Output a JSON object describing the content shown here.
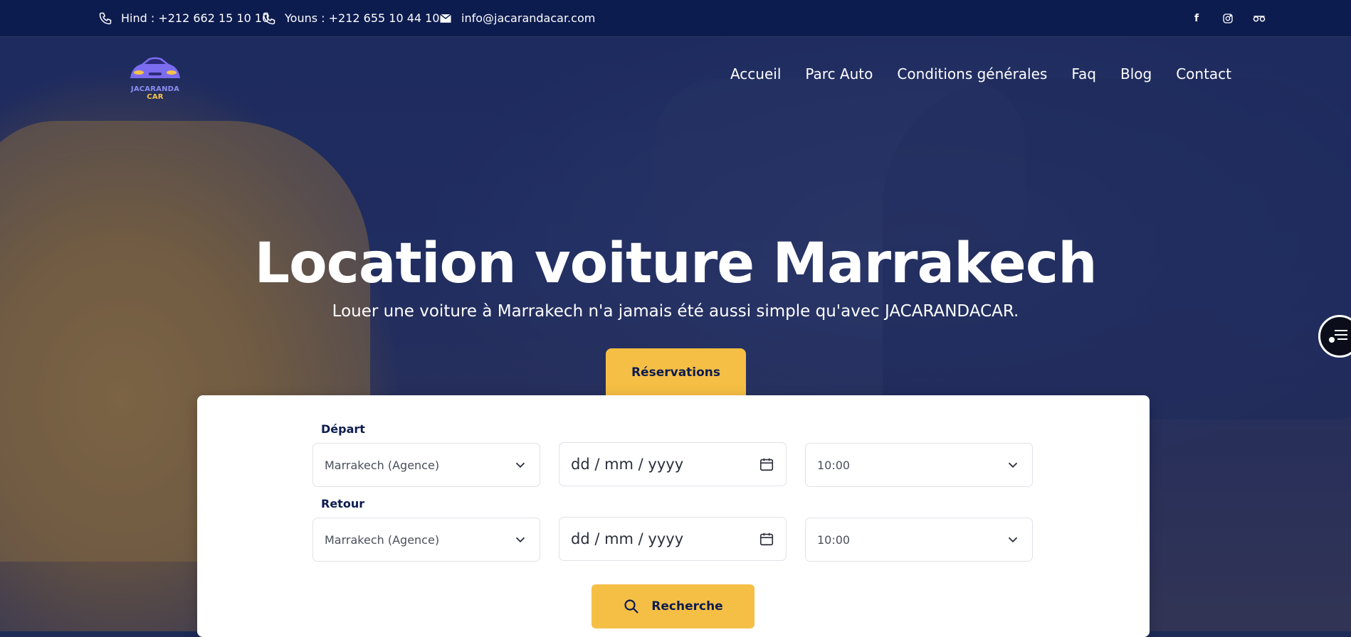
{
  "topbar": {
    "contacts": [
      {
        "icon": "phone-icon",
        "text": "Hind : +212 662 15 10 10"
      },
      {
        "icon": "phone-icon",
        "text": "Youns : +212 655 10 44 10"
      },
      {
        "icon": "mail-icon",
        "text": "info@jacarandacar.com"
      }
    ],
    "socials": [
      "facebook-icon",
      "instagram-icon",
      "tripadvisor-icon"
    ]
  },
  "logo": {
    "part1": "JACARANDA",
    "part2": "CAR"
  },
  "nav": {
    "items": [
      "Accueil",
      "Parc Auto",
      "Conditions générales",
      "Faq",
      "Blog",
      "Contact"
    ]
  },
  "hero": {
    "title": "Location voiture Marrakech",
    "subtitle": "Louer une voiture à Marrakech n'a jamais été aussi simple qu'avec JACARANDACAR."
  },
  "booking": {
    "tab_label": "Réservations",
    "departure": {
      "label": "Départ",
      "location": "Marrakech (Agence)",
      "date_placeholder": "dd / mm / yyyy",
      "time": "10:00"
    },
    "return": {
      "label": "Retour",
      "location": "Marrakech (Agence)",
      "date_placeholder": "dd / mm / yyyy",
      "time": "10:00"
    },
    "search_label": "Recherche"
  },
  "colors": {
    "navy": "#0d1c4f",
    "accent": "#f5bf45"
  }
}
